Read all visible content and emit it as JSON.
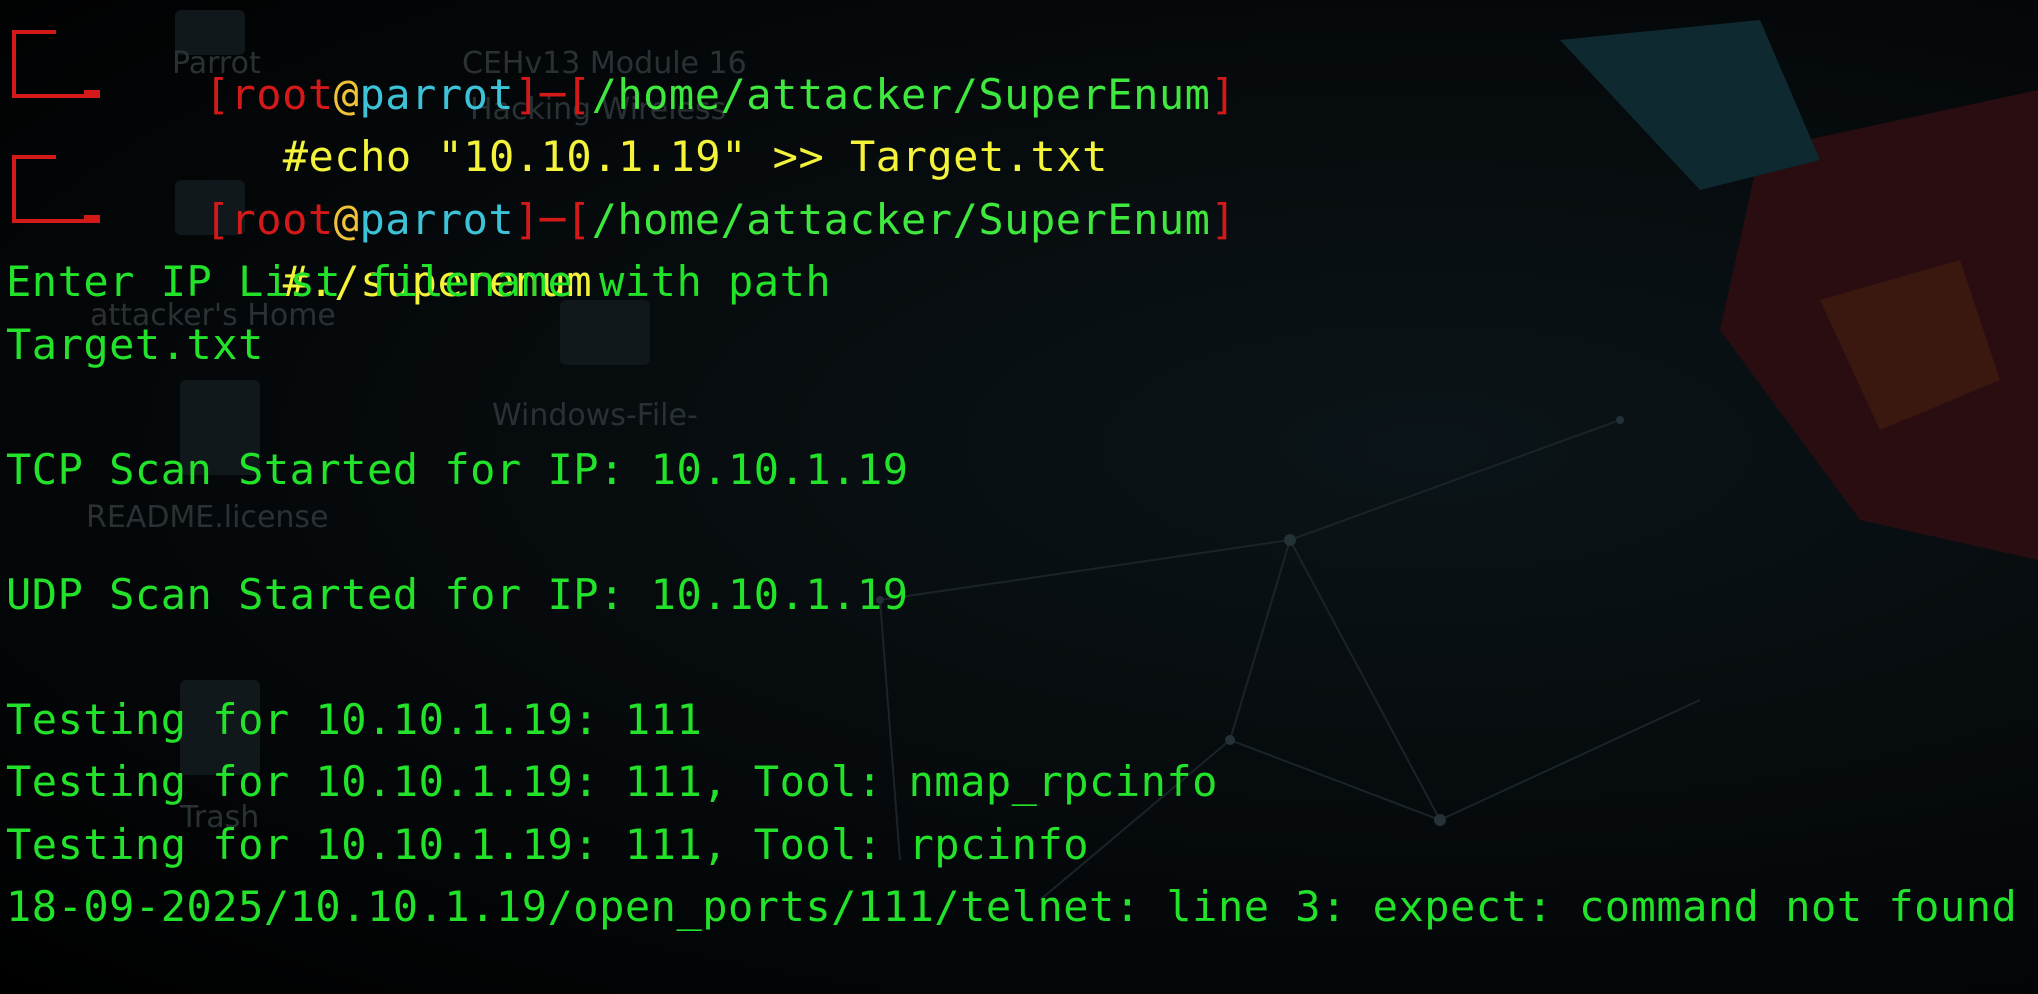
{
  "prompt": {
    "user": "root",
    "at": "@",
    "host": "parrot",
    "bracket_open": "[",
    "bracket_close": "]",
    "sep": "─",
    "cwd": "/home/attacker/SuperEnum",
    "hash": "#"
  },
  "commands": [
    "echo \"10.10.1.19\" >> Target.txt",
    "./superenum"
  ],
  "output": [
    "Enter IP List filename with path",
    "Target.txt",
    "TCP Scan Started for IP: 10.10.1.19",
    "UDP Scan Started for IP: 10.10.1.19",
    "Testing for 10.10.1.19: 111",
    "Testing for 10.10.1.19: 111, Tool: nmap_rpcinfo",
    "Testing for 10.10.1.19: 111, Tool: rpcinfo",
    "18-09-2025/10.10.1.19/open_ports/111/telnet: line 3: expect: command not found"
  ],
  "desktop_icons": [
    "Parrot",
    "CEHv13 Module 16",
    "Hacking Wireless",
    "attacker's Home",
    "Windows-File-",
    "README.license",
    "Trash"
  ],
  "colors": {
    "prompt_red": "#d41919",
    "host_cyan": "#3cc3d8",
    "path_green": "#3ee83e",
    "command_yellow": "#f3f33a",
    "output_green": "#22e32a"
  }
}
